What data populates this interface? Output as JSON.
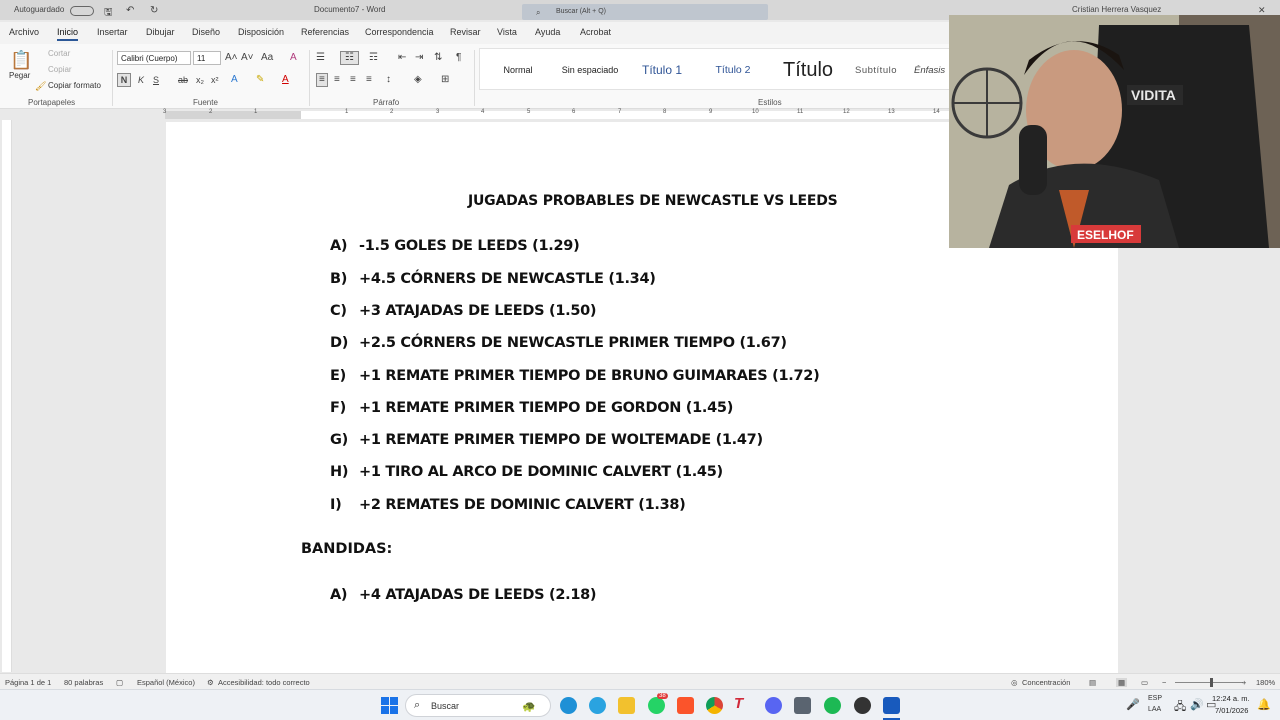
{
  "titlebar": {
    "autosave": "Autoguardado",
    "doc_name": "Documento7 - Word",
    "search_placeholder": "Buscar (Alt + Q)",
    "user": "Cristian Herrera Vasquez",
    "close_glyph": "✕"
  },
  "tabs": [
    "Archivo",
    "Inicio",
    "Insertar",
    "Dibujar",
    "Diseño",
    "Disposición",
    "Referencias",
    "Correspondencia",
    "Revisar",
    "Vista",
    "Ayuda",
    "Acrobat"
  ],
  "ribbon": {
    "clipboard": {
      "paste": "Pegar",
      "cut": "Cortar",
      "copy": "Copiar",
      "format_painter": "Copiar formato",
      "label": "Portapapeles"
    },
    "font": {
      "family": "Calibri (Cuerpo)",
      "size": "11",
      "label": "Fuente",
      "bold": "N",
      "italic": "K",
      "underline": "S"
    },
    "paragraph": {
      "label": "Párrafo"
    },
    "styles": {
      "label": "Estilos",
      "items": [
        "Normal",
        "Sin espaciado",
        "Título 1",
        "Título 2",
        "Título",
        "Subtítulo",
        "Énfasis"
      ]
    }
  },
  "ruler": {
    "numbers": [
      "3",
      "2",
      "1",
      "1",
      "2",
      "3",
      "4",
      "5",
      "6",
      "7",
      "8",
      "9",
      "10",
      "11",
      "12",
      "13",
      "14"
    ]
  },
  "document": {
    "title": "JUGADAS PROBABLES DE NEWCASTLE VS LEEDS",
    "items": [
      {
        "label": "A)",
        "text": "-1.5 GOLES DE LEEDS (1.29)"
      },
      {
        "label": "B)",
        "text": "+4.5 CÓRNERS DE NEWCASTLE (1.34)"
      },
      {
        "label": "C)",
        "text": "+3 ATAJADAS DE LEEDS (1.50)"
      },
      {
        "label": "D)",
        "text": "+2.5 CÓRNERS DE NEWCASTLE PRIMER TIEMPO (1.67)"
      },
      {
        "label": "E)",
        "text": "+1 REMATE PRIMER TIEMPO DE BRUNO GUIMARAES (1.72)"
      },
      {
        "label": "F)",
        "text": "+1 REMATE PRIMER TIEMPO DE GORDON (1.45)"
      },
      {
        "label": "G)",
        "text": "+1 REMATE PRIMER TIEMPO DE WOLTEMADE (1.47)"
      },
      {
        "label": "H)",
        "text": "+1 TIRO AL ARCO DE DOMINIC CALVERT (1.45)"
      },
      {
        "label": "I)",
        "text": "+2 REMATES DE DOMINIC CALVERT (1.38)"
      }
    ],
    "bandidas_heading": "BANDIDAS:",
    "bandidas": [
      {
        "label": "A)",
        "text": "+4 ATAJADAS DE LEEDS (2.18)"
      }
    ]
  },
  "webcam": {
    "chair_text": "VIDITA",
    "shirt_text": "ESELHOF"
  },
  "statusbar": {
    "page": "Página 1 de 1",
    "words": "80 palabras",
    "language": "Español (México)",
    "accessibility": "Accesibilidad: todo correcto",
    "focus": "Concentración",
    "zoom": "180%"
  },
  "taskbar": {
    "search": "Buscar",
    "badge": "38",
    "lang": "ESP",
    "lang2": "LAA",
    "time": "12:24 a. m.",
    "date": "7/01/2026"
  },
  "colors": {
    "accent": "#2b5797",
    "word_blue": "#185abd"
  }
}
